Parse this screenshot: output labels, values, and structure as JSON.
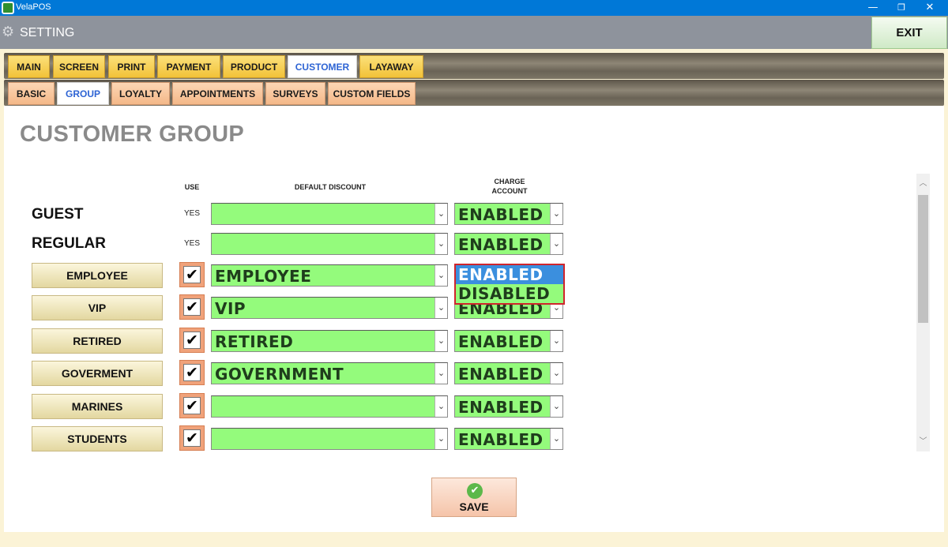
{
  "window": {
    "app_title": "VelaPOS",
    "minimize_glyph": "—",
    "maximize_glyph": "❐",
    "close_glyph": "✕"
  },
  "header": {
    "title": "SETTING",
    "gear_icon": "⚙",
    "exit_label": "EXIT"
  },
  "main_tabs": [
    "MAIN",
    "SCREEN",
    "PRINT",
    "PAYMENT",
    "PRODUCT",
    "CUSTOMER",
    "LAYAWAY"
  ],
  "main_tab_active": "CUSTOMER",
  "sub_tabs": [
    "BASIC",
    "GROUP",
    "LOYALTY",
    "APPOINTMENTS",
    "SURVEYS",
    "CUSTOM FIELDS"
  ],
  "sub_tab_active": "GROUP",
  "page": {
    "title": "CUSTOMER GROUP",
    "col_use": "USE",
    "col_default_discount": "DEFAULT DISCOUNT",
    "col_charge_line1": "CHARGE",
    "col_charge_line2": "ACCOUNT"
  },
  "fixed_rows": [
    {
      "name": "GUEST",
      "use": "YES",
      "discount": "",
      "charge": "ENABLED"
    },
    {
      "name": "REGULAR",
      "use": "YES",
      "discount": "",
      "charge": "ENABLED"
    }
  ],
  "group_rows": [
    {
      "name": "EMPLOYEE",
      "checked": "✔",
      "discount": "EMPLOYEE",
      "charge": "ENABLED"
    },
    {
      "name": "VIP",
      "checked": "✔",
      "discount": "VIP",
      "charge": "ENABLED"
    },
    {
      "name": "RETIRED",
      "checked": "✔",
      "discount": "RETIRED",
      "charge": "ENABLED"
    },
    {
      "name": "GOVERMENT",
      "checked": "✔",
      "discount": "GOVERNMENT",
      "charge": "ENABLED"
    },
    {
      "name": "MARINES",
      "checked": "✔",
      "discount": "",
      "charge": "ENABLED"
    },
    {
      "name": "STUDENTS",
      "checked": "✔",
      "discount": "",
      "charge": "ENABLED"
    }
  ],
  "dropdown": {
    "options": [
      "ENABLED",
      "DISABLED"
    ],
    "highlighted": "ENABLED"
  },
  "select_arrow_glyph": "⌄",
  "scroll": {
    "up_glyph": "︿",
    "down_glyph": "﹀"
  },
  "save": {
    "label": "SAVE",
    "icon_glyph": "✔"
  },
  "colors": {
    "field_green": "#94fb7c",
    "header_gray": "#8e939c",
    "titlebar_blue": "#0078d7",
    "active_tab_text": "#2e64d4",
    "dropdown_border": "#d0252c",
    "dropdown_highlight": "#3b8fde"
  }
}
